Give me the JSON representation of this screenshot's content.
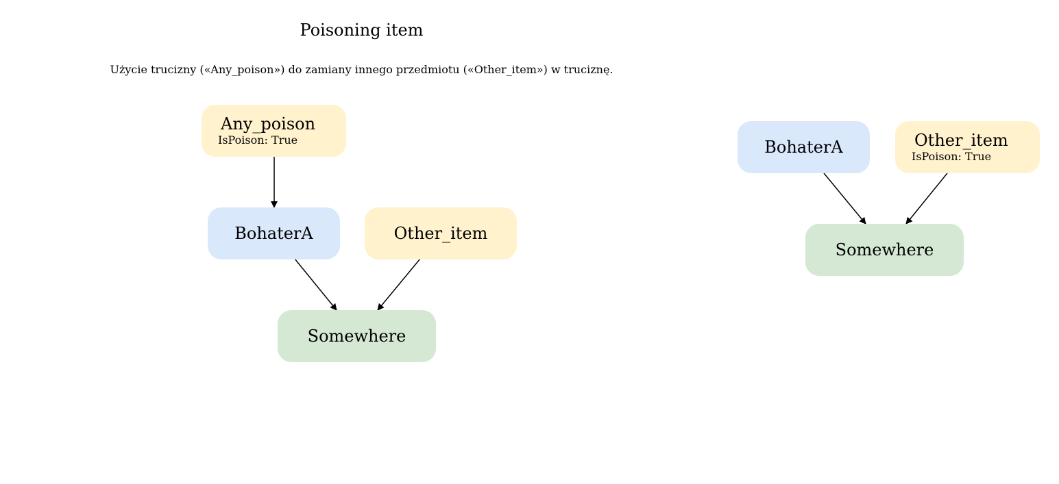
{
  "title": "Poisoning item",
  "description": "Użycie trucizny («Any_poison») do zamiany innego przedmiotu («Other_item») w truciznę.",
  "colors": {
    "hero": "#dae8fc",
    "item": "#fff2cc",
    "place": "#d5e8d4",
    "edge": "#000000"
  },
  "before": {
    "any_poison": {
      "label": "Any_poison",
      "prop": "IsPoison: True"
    },
    "hero": {
      "label": "BohaterA"
    },
    "other_item": {
      "label": "Other_item"
    },
    "place": {
      "label": "Somewhere"
    }
  },
  "after": {
    "hero": {
      "label": "BohaterA"
    },
    "other_item": {
      "label": "Other_item",
      "prop": "IsPoison: True"
    },
    "place": {
      "label": "Somewhere"
    }
  }
}
